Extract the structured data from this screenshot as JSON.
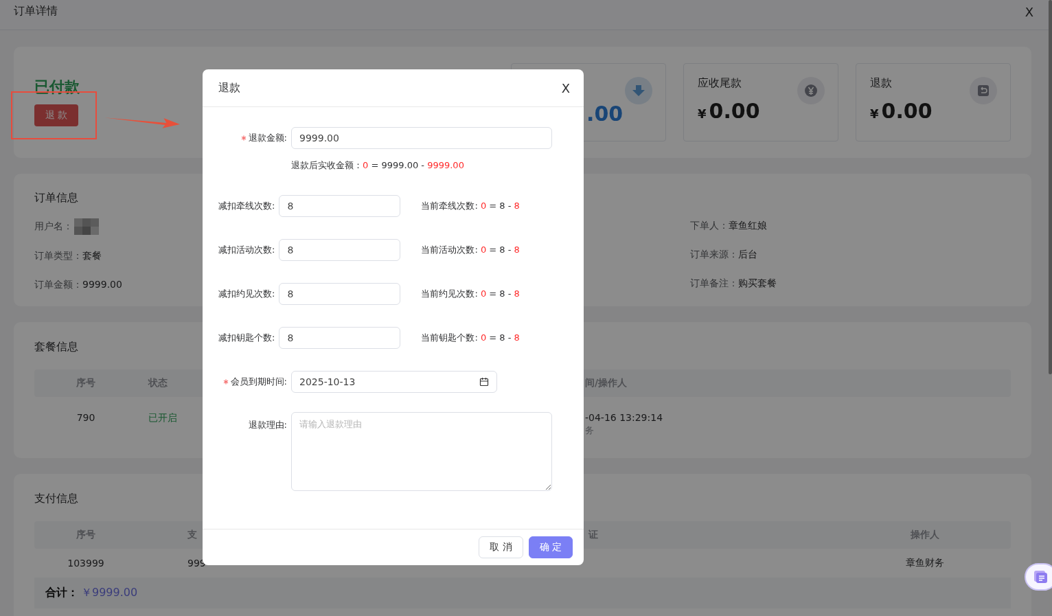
{
  "header": {
    "title": "订单详情",
    "close": "X"
  },
  "status": {
    "label": "已付款",
    "refund_button": "退 款"
  },
  "summary_cards": [
    {
      "value": ".00"
    },
    {
      "title": "应收尾款",
      "currency": "¥",
      "value": "0.00"
    },
    {
      "title": "退款",
      "currency": "¥",
      "value": "0.00"
    }
  ],
  "order_info": {
    "title": "订单信息",
    "left": [
      {
        "kind": "redacted",
        "label": "用户名："
      },
      {
        "kind": "text",
        "label": "订单类型：",
        "value": "套餐"
      },
      {
        "kind": "text",
        "label": "订单金额：",
        "value": "9999.00"
      }
    ],
    "right": [
      {
        "kind": "text",
        "label": "下单人：",
        "value": "章鱼红娘"
      },
      {
        "kind": "text",
        "label": "订单来源：",
        "value": "后台"
      },
      {
        "kind": "text",
        "label": "订单备注：",
        "value": "购买套餐"
      }
    ]
  },
  "package_info": {
    "title": "套餐信息",
    "columns": [
      "序号",
      "状态",
      "间/操作人"
    ],
    "rows": [
      {
        "number": "790",
        "status": "已开启",
        "time": "-04-16 13:29:14",
        "operator": "务"
      }
    ]
  },
  "payment_info": {
    "title": "支付信息",
    "columns": [
      "序号",
      "支",
      "证",
      "操作人"
    ],
    "rows": [
      {
        "number": "103999",
        "amount": "999",
        "operator": "章鱼财务"
      }
    ],
    "total": {
      "label": "合计：",
      "value": "￥9999.00"
    }
  },
  "refund_dialog": {
    "title": "退款",
    "close": "X",
    "amount": {
      "label": "退款金额:",
      "required": true,
      "value": "9999.00"
    },
    "amount_hint": [
      {
        "text": "退款后实收金额：",
        "highlight": false
      },
      {
        "text": "0",
        "highlight": true
      },
      {
        "text": " = 9999.00 - ",
        "highlight": false
      },
      {
        "text": "9999.00",
        "highlight": true
      }
    ],
    "deductions": [
      {
        "label": "减扣牵线次数:",
        "value": "8",
        "current": [
          {
            "text": "当前牵线次数: ",
            "highlight": false
          },
          {
            "text": "0",
            "highlight": true
          },
          {
            "text": " = 8 - ",
            "highlight": false
          },
          {
            "text": "8",
            "highlight": true
          }
        ]
      },
      {
        "label": "减扣活动次数:",
        "value": "8",
        "current": [
          {
            "text": "当前活动次数: ",
            "highlight": false
          },
          {
            "text": "0",
            "highlight": true
          },
          {
            "text": " = 8 - ",
            "highlight": false
          },
          {
            "text": "8",
            "highlight": true
          }
        ]
      },
      {
        "label": "减扣约见次数:",
        "value": "8",
        "current": [
          {
            "text": "当前约见次数: ",
            "highlight": false
          },
          {
            "text": "0",
            "highlight": true
          },
          {
            "text": " = 8 - ",
            "highlight": false
          },
          {
            "text": "8",
            "highlight": true
          }
        ]
      },
      {
        "label": "减扣钥匙个数:",
        "value": "8",
        "current": [
          {
            "text": "当前钥匙个数: ",
            "highlight": false
          },
          {
            "text": "0",
            "highlight": true
          },
          {
            "text": " = 8 - ",
            "highlight": false
          },
          {
            "text": "8",
            "highlight": true
          }
        ]
      }
    ],
    "expiry": {
      "label": "会员到期时间:",
      "required": true,
      "value": "2025-10-13"
    },
    "reason": {
      "label": "退款理由:",
      "placeholder": "请输入退款理由"
    },
    "buttons": {
      "cancel": "取 消",
      "confirm": "确 定"
    }
  }
}
